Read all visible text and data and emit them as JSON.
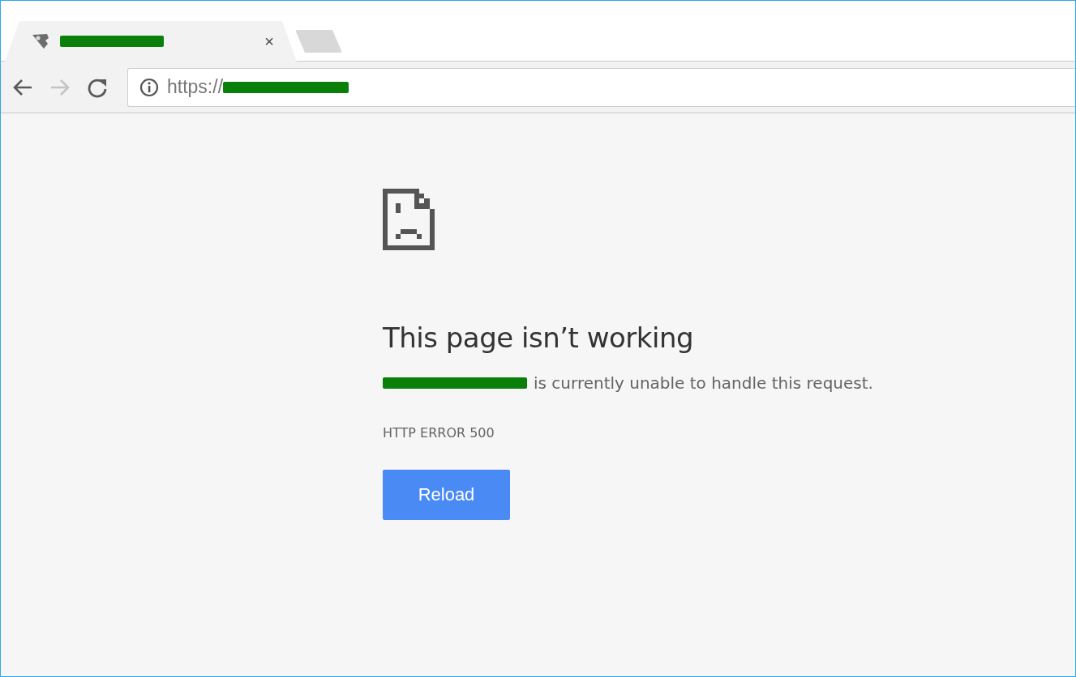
{
  "tabs": [
    {
      "redacted": true,
      "selected": true,
      "close": "×"
    },
    {
      "kind": "new-tab"
    }
  ],
  "toolbar": {
    "back_enabled": true,
    "forward_enabled": false,
    "address": {
      "scheme": "https://",
      "redacted": true
    }
  },
  "error": {
    "heading": "This page isn’t working",
    "host_redacted": true,
    "message": "is currently unable to handle this request.",
    "code": "HTTP ERROR 500",
    "button": "Reload"
  }
}
